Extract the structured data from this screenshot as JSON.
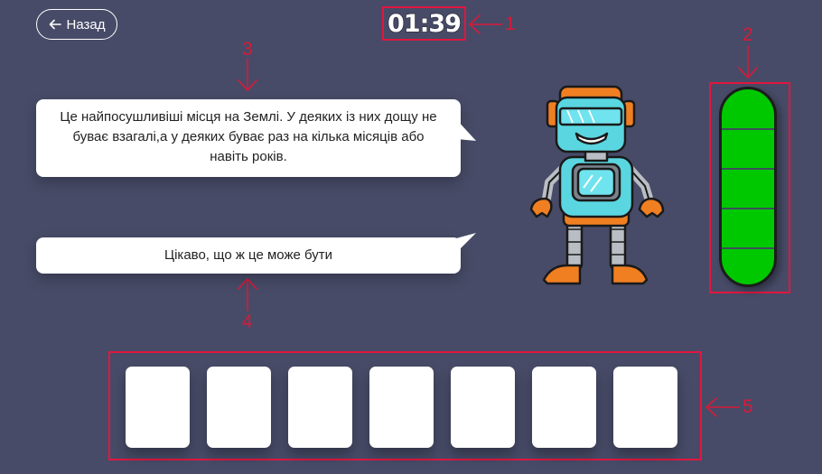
{
  "back_button": {
    "label": "Назад",
    "icon": "arrow-left-icon"
  },
  "timer": {
    "value": "01:39"
  },
  "markers": [
    "1",
    "2",
    "3",
    "4",
    "5"
  ],
  "bubbles": {
    "clue": "Це найпосушливіші місця на Землі. У деяких із них дощу не буває взагалі,а у деяких буває раз на кілька місяців або навіть років.",
    "reply": "Цікаво, що ж це може бути"
  },
  "energy": {
    "level": 1.0,
    "color": "#00c800"
  },
  "answer_slots": {
    "count": 7
  },
  "colors": {
    "background": "#474b67",
    "accent": "#e2163f",
    "bubble": "#ffffff"
  }
}
